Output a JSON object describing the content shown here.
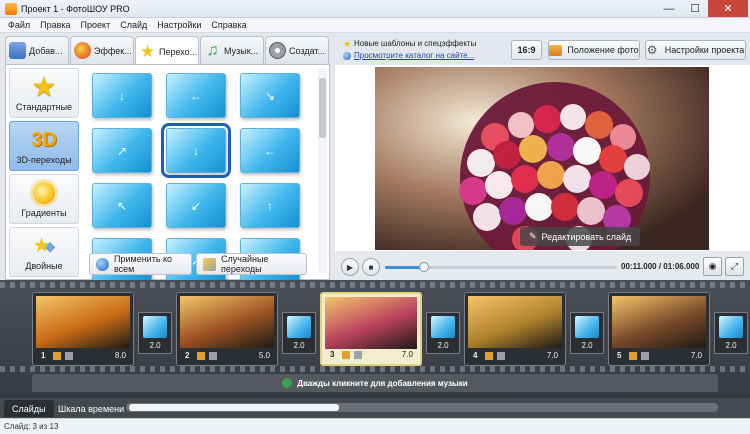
{
  "window": {
    "title": "Проект 1 - ФотоШОУ PRO",
    "minimize": "—",
    "maximize": "☐",
    "close": "✕"
  },
  "menu": [
    "Файл",
    "Правка",
    "Проект",
    "Слайд",
    "Настройки",
    "Справка"
  ],
  "tabs": [
    {
      "label": "Добав...",
      "icon": "add-icon",
      "color": "#4d7fd1"
    },
    {
      "label": "Эффек...",
      "icon": "palette-icon",
      "color": "#e88b2a"
    },
    {
      "label": "Перехо...",
      "icon": "star-icon",
      "color": "#f3c317"
    },
    {
      "label": "Музык...",
      "icon": "music-note-icon",
      "color": "#3aa24a"
    },
    {
      "label": "Создат...",
      "icon": "film-reel-icon",
      "color": "#8a8f96"
    }
  ],
  "categories": [
    {
      "label": "Стандартные",
      "icon": "star-icon"
    },
    {
      "label": "3D-переходы",
      "icon": "3d-icon",
      "icon_text": "3D"
    },
    {
      "label": "Градиенты",
      "icon": "sun-icon"
    },
    {
      "label": "Двойные",
      "icon": "double-star-icon"
    }
  ],
  "transitions": {
    "count": 12,
    "selected_index": 4,
    "arrows": [
      "↓",
      "←",
      "↘",
      "↗",
      "↓",
      "←",
      "↖",
      "↙",
      "↑",
      "↖",
      "↗",
      "←"
    ]
  },
  "buttons": {
    "apply_all": "Применить ко всем",
    "random": "Случайные переходы"
  },
  "news": {
    "line1": "Новые шаблоны и спецэффекты",
    "line2": "Просмотрите каталог на сайте..."
  },
  "top_buttons": {
    "ratio": "16:9",
    "photo_position": "Положение фото",
    "project_settings": "Настройки проекта"
  },
  "preview": {
    "edit_slide": "Редактировать слайд"
  },
  "player": {
    "time": "00:11.000 / 01:06.000",
    "progress": 0.17,
    "play": "▶",
    "stop": "■",
    "snapshot": "◉",
    "fullscreen": "⤢"
  },
  "slides": [
    {
      "num": "1",
      "duration": "8.0",
      "color": "#c86a14"
    },
    {
      "num": "2",
      "duration": "5.0",
      "color": "#9b5222"
    },
    {
      "num": "3",
      "duration": "7.0",
      "color": "#b8405e"
    },
    {
      "num": "4",
      "duration": "7.0",
      "color": "#b0822c"
    },
    {
      "num": "5",
      "duration": "7.0",
      "color": "#7a4a2a"
    }
  ],
  "transition_durations": [
    "2.0",
    "2.0",
    "2.0",
    "2.0",
    "2.0"
  ],
  "music_hint": "Дважды кликните для добавления музыки",
  "bottom_tabs": {
    "slides": "Слайды",
    "timeline": "Шкала времени"
  },
  "status": "Слайд: 3 из 13"
}
